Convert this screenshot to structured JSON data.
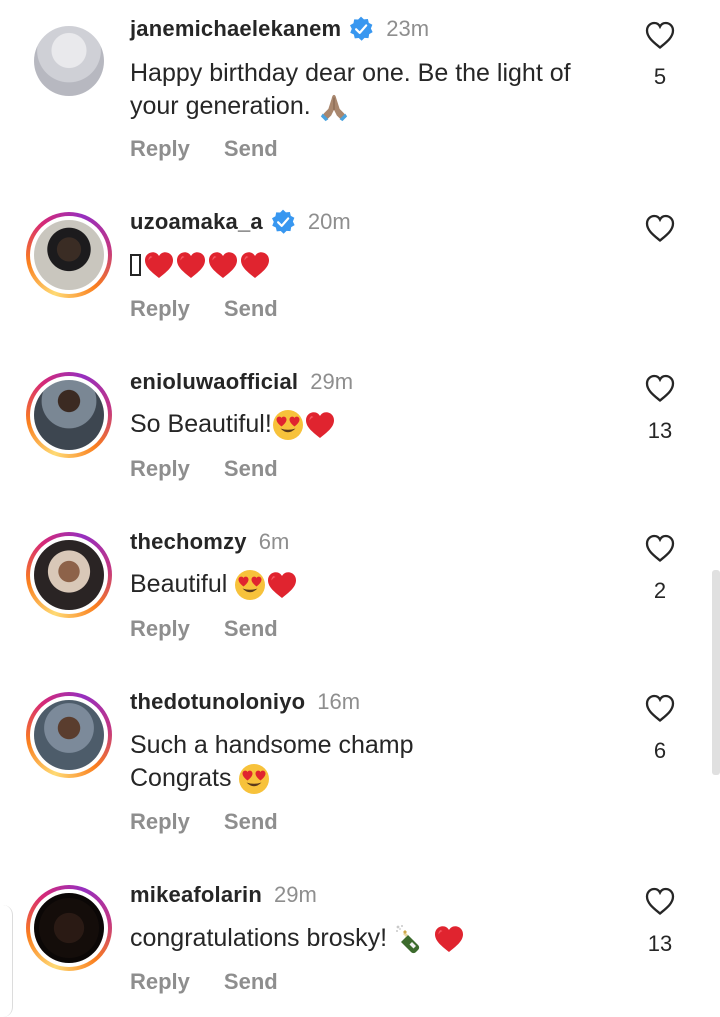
{
  "comments": [
    {
      "username": "janemichaelekanem",
      "verified": true,
      "time": "23m",
      "text": "Happy birthday dear one. Be the light of your generation.",
      "emoji_tail": "folded-hands",
      "likes": "5",
      "reply": "Reply",
      "send": "Send",
      "story_ring": false
    },
    {
      "username": "uzoamaka_a",
      "verified": true,
      "time": "20m",
      "text": "",
      "emoji_tail": "tofu + 4 red hearts",
      "likes": "",
      "reply": "Reply",
      "send": "Send",
      "story_ring": true
    },
    {
      "username": "enioluwaofficial",
      "verified": false,
      "time": "29m",
      "text": "So Beautiful!",
      "emoji_tail": "heart-eyes + red heart",
      "likes": "13",
      "reply": "Reply",
      "send": "Send",
      "story_ring": true
    },
    {
      "username": "thechomzy",
      "verified": false,
      "time": "6m",
      "text": "Beautiful",
      "emoji_tail": "heart-eyes + red heart",
      "likes": "2",
      "reply": "Reply",
      "send": "Send",
      "story_ring": true
    },
    {
      "username": "thedotunoloniyo",
      "verified": false,
      "time": "16m",
      "text": "Such a handsome champ",
      "text2": "Congrats",
      "emoji_tail": "heart-eyes",
      "likes": "6",
      "reply": "Reply",
      "send": "Send",
      "story_ring": true
    },
    {
      "username": "mikeafolarin",
      "verified": false,
      "time": "29m",
      "text": "congratulations brosky!",
      "emoji_tail": "champagne + red heart",
      "likes": "13",
      "reply": "Reply",
      "send": "Send",
      "story_ring": true
    }
  ],
  "colors": {
    "verified_blue": "#3897f0",
    "heart_red": "#e0242f",
    "muted_text": "#8e8e8e"
  }
}
